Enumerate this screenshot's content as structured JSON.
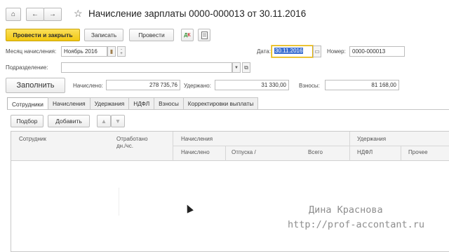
{
  "header": {
    "title": "Начисление зарплаты 0000-000013 от 30.11.2016",
    "home_icon": "home-icon",
    "back_icon": "arrow-left-icon",
    "forward_icon": "arrow-right-icon",
    "star_icon": "star-icon"
  },
  "toolbar": {
    "post_close_label": "Провести и закрыть",
    "save_label": "Записать",
    "post_label": "Провести",
    "dt_kt_label": "Дт Кт",
    "report_icon": "document-icon"
  },
  "form": {
    "month_label": "Месяц начисления:",
    "month_value": "Ноябрь 2016",
    "division_label": "Подразделение:",
    "division_value": "",
    "date_label": "Дата:",
    "date_value": "30.11.2016",
    "number_label": "Номер:",
    "number_value": "0000-000013",
    "fill_label": "Заполнить",
    "accrued_label": "Начислено:",
    "accrued_value": "278 735,76",
    "withheld_label": "Удержано:",
    "withheld_value": "31 330,00",
    "contrib_label": "Взносы:",
    "contrib_value": "81 168,00"
  },
  "tabs": [
    "Сотрудники",
    "Начисления",
    "Удержания",
    "НДФЛ",
    "Взносы",
    "Корректировки выплаты"
  ],
  "table_toolbar": {
    "pick_label": "Подбор",
    "add_label": "Добавить"
  },
  "grid": {
    "col_employee": "Сотрудник",
    "col_worked": "Отработано",
    "col_worked_units": "дн./чс.",
    "group_accruals": "Начисления",
    "col_accrued": "Начислено",
    "col_vacation": "Отпуска /",
    "col_total": "Всего",
    "group_withholdings": "Удержания",
    "col_ndfl": "НДФЛ",
    "col_other": "Прочее"
  },
  "watermark": {
    "author": "Дина Краснова",
    "url": "http://prof-accontant.ru"
  },
  "colors": {
    "primary_button": "#f2c812",
    "focus_border": "#e4b200",
    "selection": "#3b6fd1"
  }
}
